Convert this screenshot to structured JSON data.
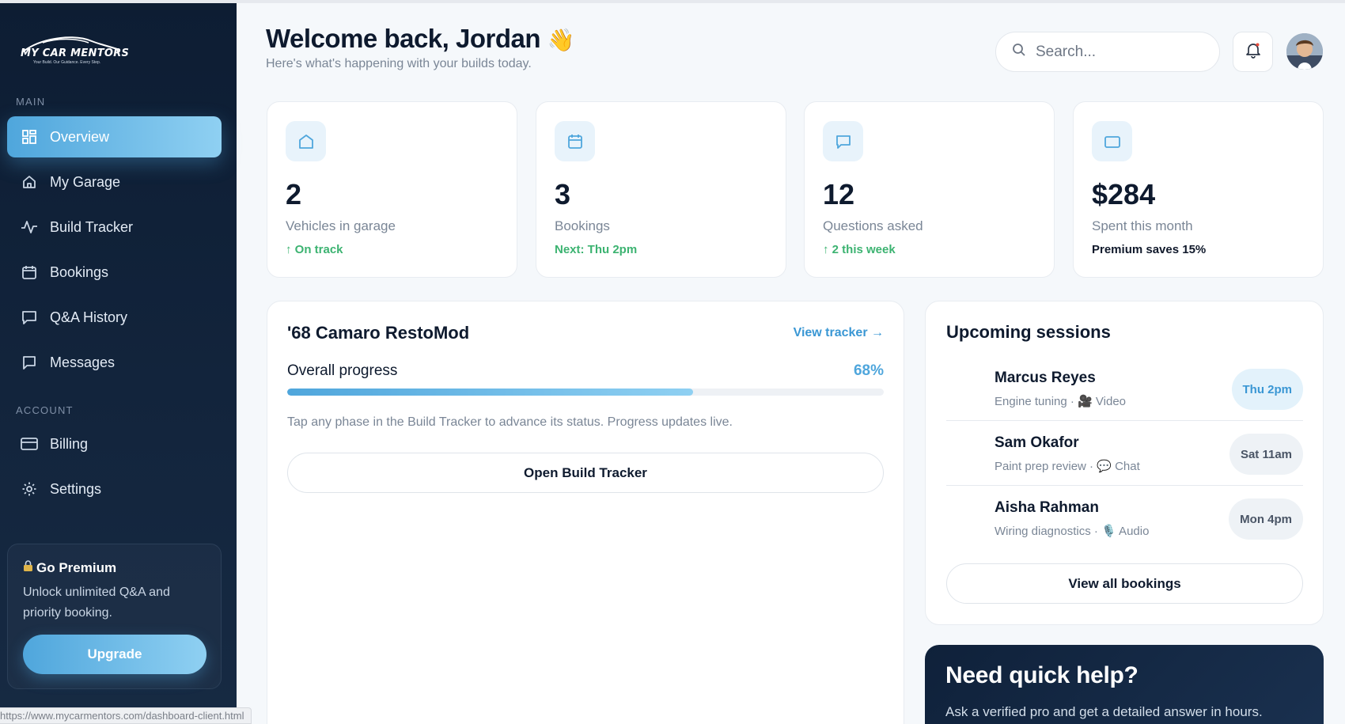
{
  "brand": {
    "logo_text": "MY CAR MENTORS",
    "logo_tagline": "Your Build. Our Guidance. Every Step."
  },
  "sidebar": {
    "main_heading": "MAIN",
    "account_heading": "ACCOUNT",
    "main_items": [
      {
        "label": "Overview",
        "icon": "grid-icon",
        "active": true
      },
      {
        "label": "My Garage",
        "icon": "home-icon",
        "active": false
      },
      {
        "label": "Build Tracker",
        "icon": "activity-icon",
        "active": false
      },
      {
        "label": "Bookings",
        "icon": "calendar-icon",
        "active": false
      },
      {
        "label": "Q&A History",
        "icon": "chat-icon",
        "active": false
      },
      {
        "label": "Messages",
        "icon": "message-icon",
        "active": false
      }
    ],
    "account_items": [
      {
        "label": "Billing",
        "icon": "card-icon"
      },
      {
        "label": "Settings",
        "icon": "gear-icon"
      }
    ],
    "premium": {
      "icon": "lock-icon",
      "title": "Go Premium",
      "desc": "Unlock unlimited Q&A and priority booking.",
      "button": "Upgrade"
    }
  },
  "header": {
    "welcome": "Welcome back, Jordan",
    "wave_emoji": "👋",
    "subtitle": "Here's what's happening with your builds today.",
    "search_placeholder": "Search..."
  },
  "stats": [
    {
      "icon": "home-icon",
      "value": "2",
      "label": "Vehicles in garage",
      "note": "↑ On track"
    },
    {
      "icon": "calendar-icon",
      "value": "3",
      "label": "Bookings",
      "note": "Next: Thu 2pm"
    },
    {
      "icon": "chat-icon",
      "value": "12",
      "label": "Questions asked",
      "note": "↑ 2 this week"
    },
    {
      "icon": "card-icon",
      "value": "$284",
      "label": "Spent this month",
      "note": "Premium saves 15%"
    }
  ],
  "build": {
    "title": "'68 Camaro RestoMod",
    "view_link": "View tracker →",
    "progress_label": "Overall progress",
    "progress_value": 68,
    "progress_text": "68%",
    "note": "Tap any phase in the Build Tracker to advance its status. Progress updates live.",
    "button": "Open Build Tracker"
  },
  "sessions": {
    "title": "Upcoming sessions",
    "items": [
      {
        "name": "Marcus Reyes",
        "meta": "Engine tuning · 🎥 Video",
        "time": "Thu 2pm"
      },
      {
        "name": "Sam Okafor",
        "meta": "Paint prep review · 💬 Chat",
        "time": "Sat 11am"
      },
      {
        "name": "Aisha Rahman",
        "meta": "Wiring diagnostics · 🎙️ Audio",
        "time": "Mon 4pm"
      }
    ],
    "button": "View all bookings"
  },
  "help": {
    "title": "Need quick help?",
    "desc": "Ask a verified pro and get a detailed answer in hours."
  },
  "status_url": "https://www.mycarmentors.com/dashboard-client.html",
  "colors": {
    "accent": "#4fa6dc",
    "accent_light": "#8fd0f2",
    "sidebar_bg": "#0d1d33",
    "success": "#3cb371"
  }
}
